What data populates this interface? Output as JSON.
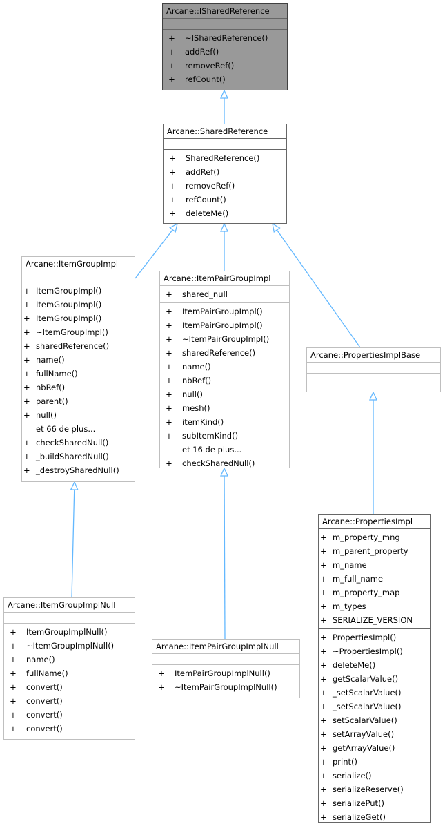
{
  "colors": {
    "edge": "#63b8ff",
    "focus_bg": "#999999",
    "box_border": "#bfbfbf"
  },
  "classes": {
    "ishared": {
      "title": "Arcane::ISharedReference",
      "attributes": [],
      "methods": [
        {
          "vis": "+",
          "name": "~ISharedReference()"
        },
        {
          "vis": "+",
          "name": "addRef()"
        },
        {
          "vis": "+",
          "name": "removeRef()"
        },
        {
          "vis": "+",
          "name": "refCount()"
        }
      ]
    },
    "shared": {
      "title": "Arcane::SharedReference",
      "attributes": [],
      "methods": [
        {
          "vis": "+",
          "name": "SharedReference()"
        },
        {
          "vis": "+",
          "name": "addRef()"
        },
        {
          "vis": "+",
          "name": "removeRef()"
        },
        {
          "vis": "+",
          "name": "refCount()"
        },
        {
          "vis": "+",
          "name": "deleteMe()"
        }
      ]
    },
    "itemgroup": {
      "title": "Arcane::ItemGroupImpl",
      "attributes": [],
      "methods": [
        {
          "vis": "+",
          "name": "ItemGroupImpl()"
        },
        {
          "vis": "+",
          "name": "ItemGroupImpl()"
        },
        {
          "vis": "+",
          "name": "ItemGroupImpl()"
        },
        {
          "vis": "+",
          "name": "~ItemGroupImpl()"
        },
        {
          "vis": "+",
          "name": "sharedReference()"
        },
        {
          "vis": "+",
          "name": "name()"
        },
        {
          "vis": "+",
          "name": "fullName()"
        },
        {
          "vis": "+",
          "name": "nbRef()"
        },
        {
          "vis": "+",
          "name": "parent()"
        },
        {
          "vis": "+",
          "name": "null()"
        },
        {
          "vis": "",
          "name": "et 66 de plus..."
        },
        {
          "vis": "+",
          "name": "checkSharedNull()"
        },
        {
          "vis": "+",
          "name": "_buildSharedNull()"
        },
        {
          "vis": "+",
          "name": "_destroySharedNull()"
        }
      ]
    },
    "itempair": {
      "title": "Arcane::ItemPairGroupImpl",
      "attributes": [
        {
          "vis": "+",
          "name": "shared_null"
        }
      ],
      "methods": [
        {
          "vis": "+",
          "name": "ItemPairGroupImpl()"
        },
        {
          "vis": "+",
          "name": "ItemPairGroupImpl()"
        },
        {
          "vis": "+",
          "name": "~ItemPairGroupImpl()"
        },
        {
          "vis": "+",
          "name": "sharedReference()"
        },
        {
          "vis": "+",
          "name": "name()"
        },
        {
          "vis": "+",
          "name": "nbRef()"
        },
        {
          "vis": "+",
          "name": "null()"
        },
        {
          "vis": "+",
          "name": "mesh()"
        },
        {
          "vis": "+",
          "name": "itemKind()"
        },
        {
          "vis": "+",
          "name": "subItemKind()"
        },
        {
          "vis": "",
          "name": "et 16 de plus..."
        },
        {
          "vis": "+",
          "name": "checkSharedNull()"
        }
      ]
    },
    "propbase": {
      "title": "Arcane::PropertiesImplBase",
      "attributes": [],
      "methods": []
    },
    "props": {
      "title": "Arcane::PropertiesImpl",
      "attributes": [
        {
          "vis": "+",
          "name": "m_property_mng"
        },
        {
          "vis": "+",
          "name": "m_parent_property"
        },
        {
          "vis": "+",
          "name": "m_name"
        },
        {
          "vis": "+",
          "name": "m_full_name"
        },
        {
          "vis": "+",
          "name": "m_property_map"
        },
        {
          "vis": "+",
          "name": "m_types"
        },
        {
          "vis": "+",
          "name": "SERIALIZE_VERSION"
        }
      ],
      "methods": [
        {
          "vis": "+",
          "name": "PropertiesImpl()"
        },
        {
          "vis": "+",
          "name": "~PropertiesImpl()"
        },
        {
          "vis": "+",
          "name": "deleteMe()"
        },
        {
          "vis": "+",
          "name": "getScalarValue()"
        },
        {
          "vis": "+",
          "name": "_setScalarValue()"
        },
        {
          "vis": "+",
          "name": "_setScalarValue()"
        },
        {
          "vis": "+",
          "name": "setScalarValue()"
        },
        {
          "vis": "+",
          "name": "setArrayValue()"
        },
        {
          "vis": "+",
          "name": "getArrayValue()"
        },
        {
          "vis": "+",
          "name": "print()"
        },
        {
          "vis": "+",
          "name": "serialize()"
        },
        {
          "vis": "+",
          "name": "serializeReserve()"
        },
        {
          "vis": "+",
          "name": "serializePut()"
        },
        {
          "vis": "+",
          "name": "serializeGet()"
        }
      ]
    },
    "itemgroupnull": {
      "title": "Arcane::ItemGroupImplNull",
      "attributes": [],
      "methods": [
        {
          "vis": "+",
          "name": "ItemGroupImplNull()"
        },
        {
          "vis": "+",
          "name": "~ItemGroupImplNull()"
        },
        {
          "vis": "+",
          "name": "name()"
        },
        {
          "vis": "+",
          "name": "fullName()"
        },
        {
          "vis": "+",
          "name": "convert()"
        },
        {
          "vis": "+",
          "name": "convert()"
        },
        {
          "vis": "+",
          "name": "convert()"
        },
        {
          "vis": "+",
          "name": "convert()"
        }
      ]
    },
    "itempairnull": {
      "title": "Arcane::ItemPairGroupImplNull",
      "attributes": [],
      "methods": [
        {
          "vis": "+",
          "name": "ItemPairGroupImplNull()"
        },
        {
          "vis": "+",
          "name": "~ItemPairGroupImplNull()"
        }
      ]
    }
  },
  "inheritance": [
    {
      "child": "shared",
      "parent": "ishared"
    },
    {
      "child": "itemgroup",
      "parent": "shared"
    },
    {
      "child": "itempair",
      "parent": "shared"
    },
    {
      "child": "propbase",
      "parent": "shared"
    },
    {
      "child": "itemgroupnull",
      "parent": "itemgroup"
    },
    {
      "child": "itempairnull",
      "parent": "itempair"
    },
    {
      "child": "props",
      "parent": "propbase"
    }
  ]
}
